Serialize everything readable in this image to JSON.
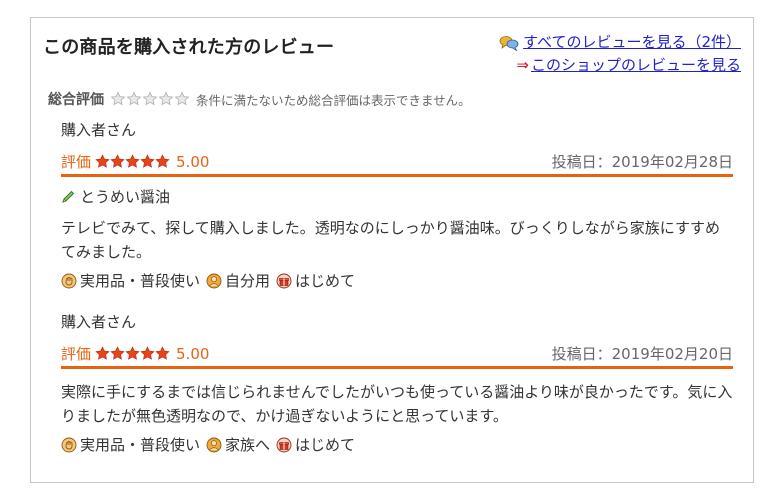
{
  "header": {
    "title": "この商品を購入された方のレビュー",
    "all_reviews_link": "すべてのレビューを見る（2件）",
    "shop_reviews_arrow": "⇒",
    "shop_reviews_link": "このショップのレビューを見る"
  },
  "overall": {
    "label": "総合評価",
    "note": "条件に満たないため総合評価は表示できません。"
  },
  "reviews": [
    {
      "reviewer": "購入者さん",
      "rating_label": "評価",
      "rating": 5,
      "score": "5.00",
      "posted": "投稿日：2019年02月28日",
      "title": "とうめい醤油",
      "body": "テレビでみて、探して購入しました。透明なのにしっかり醤油味。びっくりしながら家族にすすめてみました。",
      "tags": [
        "実用品・普段使い",
        "自分用",
        "はじめて"
      ]
    },
    {
      "reviewer": "購入者さん",
      "rating_label": "評価",
      "rating": 5,
      "score": "5.00",
      "posted": "投稿日：2019年02月20日",
      "title": "",
      "body": "実際に手にするまでは信じられませんでしたがいつも使っている醤油より味が良かったです。気に入りましたが無色透明なので、かけ過ぎないようにと思っています。",
      "tags": [
        "実用品・普段使い",
        "家族へ",
        "はじめて"
      ]
    }
  ],
  "icons": {
    "reviews_link": "speech-bubbles-icon",
    "title": "pencil-icon",
    "tag_use": "hand-icon",
    "tag_who": "person-icon",
    "tag_first": "gift-icon"
  },
  "colors": {
    "accent": "#e8620f",
    "link": "#2222cc",
    "arrow": "#e60012",
    "star_active": "#e8431a",
    "star_inactive": "#c8c8c8"
  }
}
